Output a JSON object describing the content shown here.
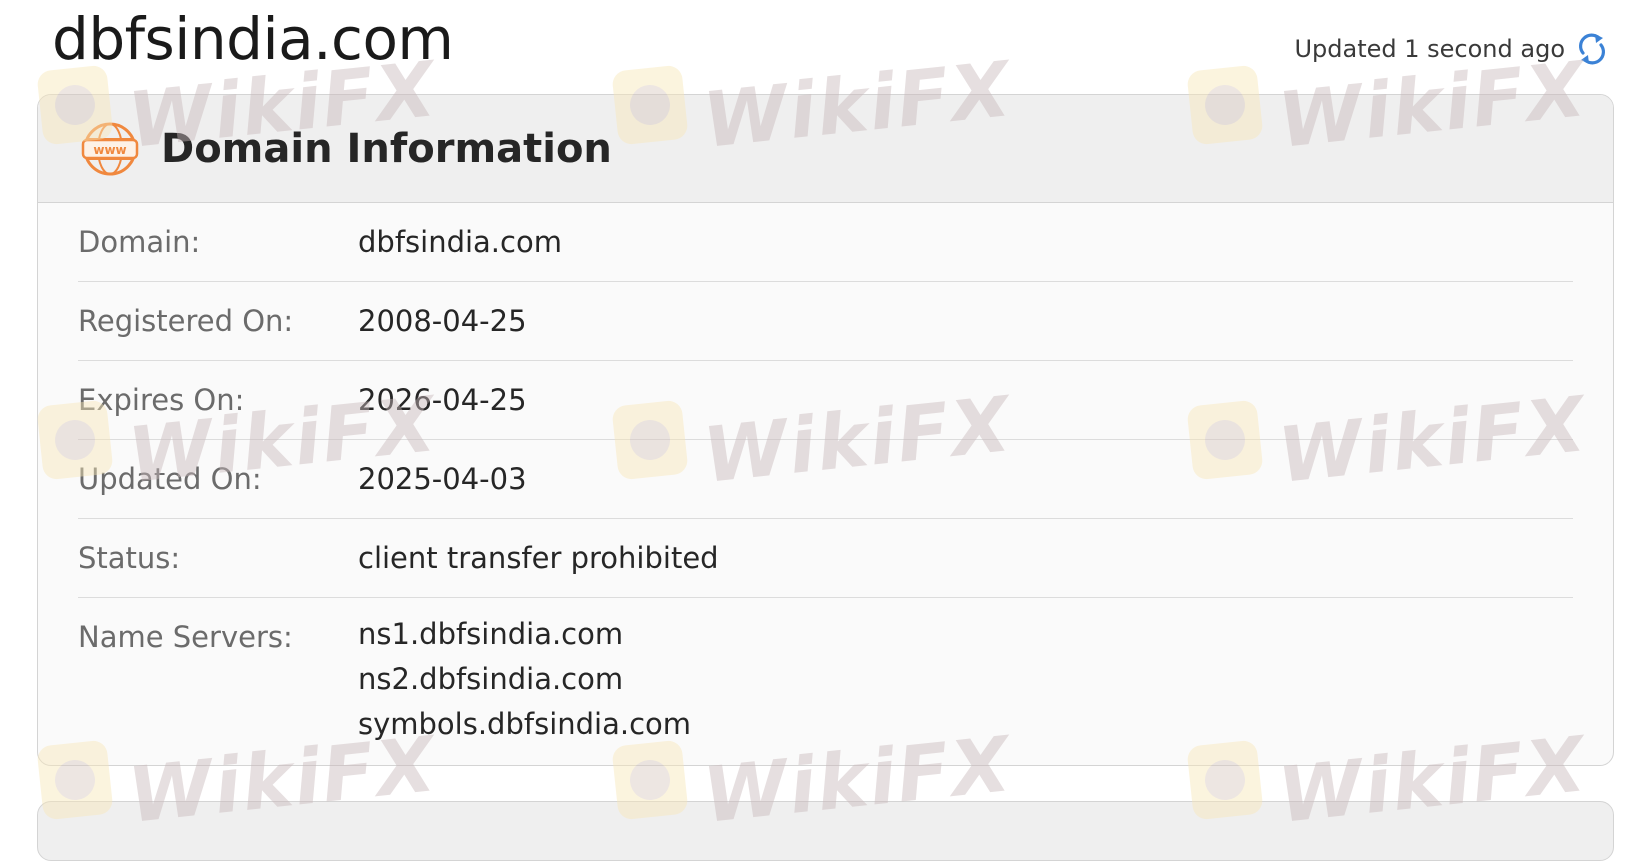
{
  "page": {
    "title": "dbfsindia.com",
    "updated_text": "Updated 1 second ago",
    "refresh_icon": "refresh-icon"
  },
  "domain_card": {
    "icon": "www-icon",
    "title": "Domain Information",
    "rows": [
      {
        "label": "Domain:",
        "value": "dbfsindia.com"
      },
      {
        "label": "Registered On:",
        "value": "2008-04-25"
      },
      {
        "label": "Expires On:",
        "value": "2026-04-25"
      },
      {
        "label": "Updated On:",
        "value": "2025-04-03"
      },
      {
        "label": "Status:",
        "value": "client transfer prohibited"
      }
    ],
    "name_servers": {
      "label": "Name Servers:",
      "values": [
        "ns1.dbfsindia.com",
        "ns2.dbfsindia.com",
        "symbols.dbfsindia.com"
      ]
    }
  },
  "watermark": {
    "text": "WikiFX"
  },
  "colors": {
    "accent_orange": "#f0883e",
    "refresh_blue": "#3b82d6",
    "header_bg": "#efefef",
    "card_bg": "#fafafa"
  }
}
